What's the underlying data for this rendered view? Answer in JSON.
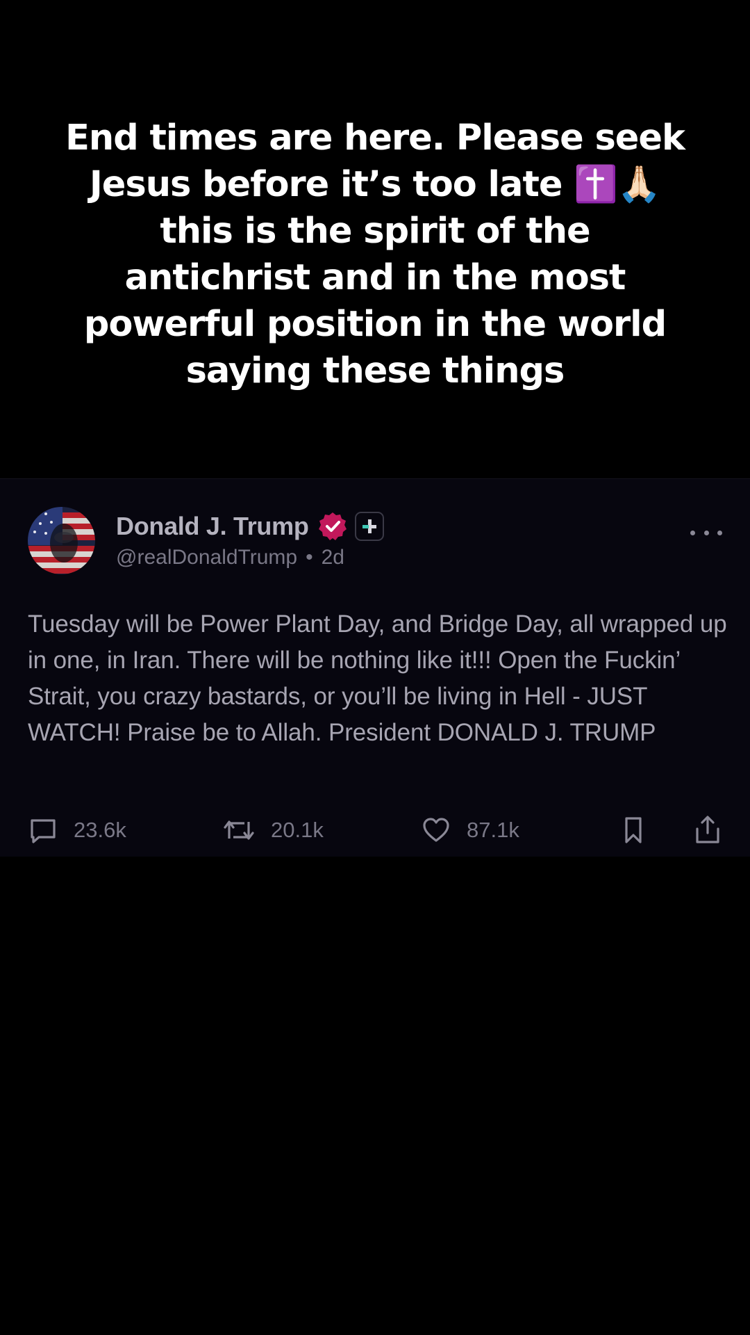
{
  "overlay": {
    "caption": "End times are here. Please seek Jesus before it’s too late ✝️🙏🏻 this is the spirit of the antichrist and in the most powerful position in the world saying these things"
  },
  "post": {
    "display_name": "Donald J. Trump",
    "handle": "@realDonaldTrump",
    "separator": "•",
    "time_ago": "2d",
    "body": "Tuesday will be Power Plant Day, and Bridge Day, all wrapped up in one, in Iran. There will be nothing like it!!! Open the Fuckin’ Strait, you crazy bastards, or you’ll be living in Hell - JUST WATCH! Praise be to Allah. President DONALD J. TRUMP",
    "stats": {
      "replies": "23.6k",
      "reposts": "20.1k",
      "likes": "87.1k"
    },
    "icons": {
      "verified": "verified-badge-icon",
      "plus": "plus-badge-icon",
      "more": "more-options-icon",
      "reply": "reply-icon",
      "repost": "repost-icon",
      "like": "heart-icon",
      "bookmark": "bookmark-icon",
      "share": "share-icon"
    },
    "colors": {
      "card_background": "#07060f",
      "verified_badge": "#c2185b",
      "text_primary": "#b5b3bf",
      "text_secondary": "#7a7887"
    }
  }
}
